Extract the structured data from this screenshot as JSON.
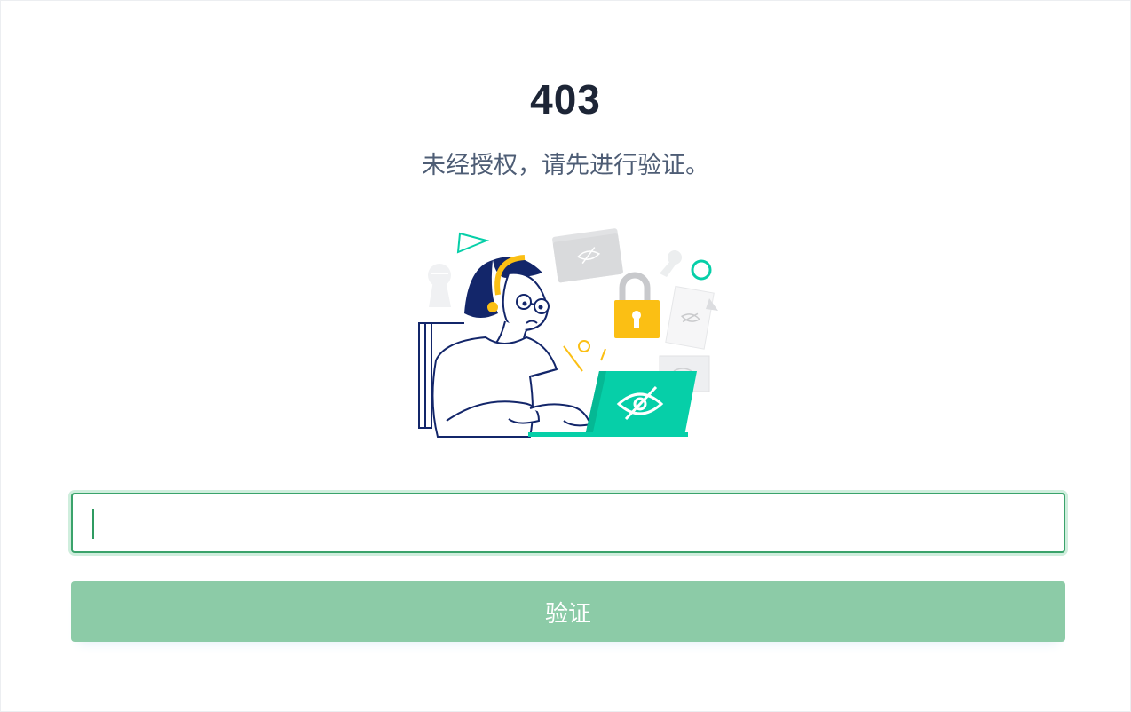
{
  "error": {
    "code": "403",
    "message": "未经授权，请先进行验证。"
  },
  "form": {
    "input_value": "",
    "input_placeholder": "",
    "submit_label": "验证"
  },
  "colors": {
    "accent": "#3aa36b",
    "button": "#8ccba7",
    "title": "#1d2536",
    "message": "#4e5d75",
    "illustration_teal": "#06cfa8",
    "illustration_yellow": "#fbbf14",
    "illustration_navy": "#13266a"
  },
  "icons": [
    "lock-icon",
    "eye-slash-icon",
    "folder-icon",
    "keyhole-icon",
    "document-icon",
    "triangle-icon",
    "circle-icon"
  ]
}
